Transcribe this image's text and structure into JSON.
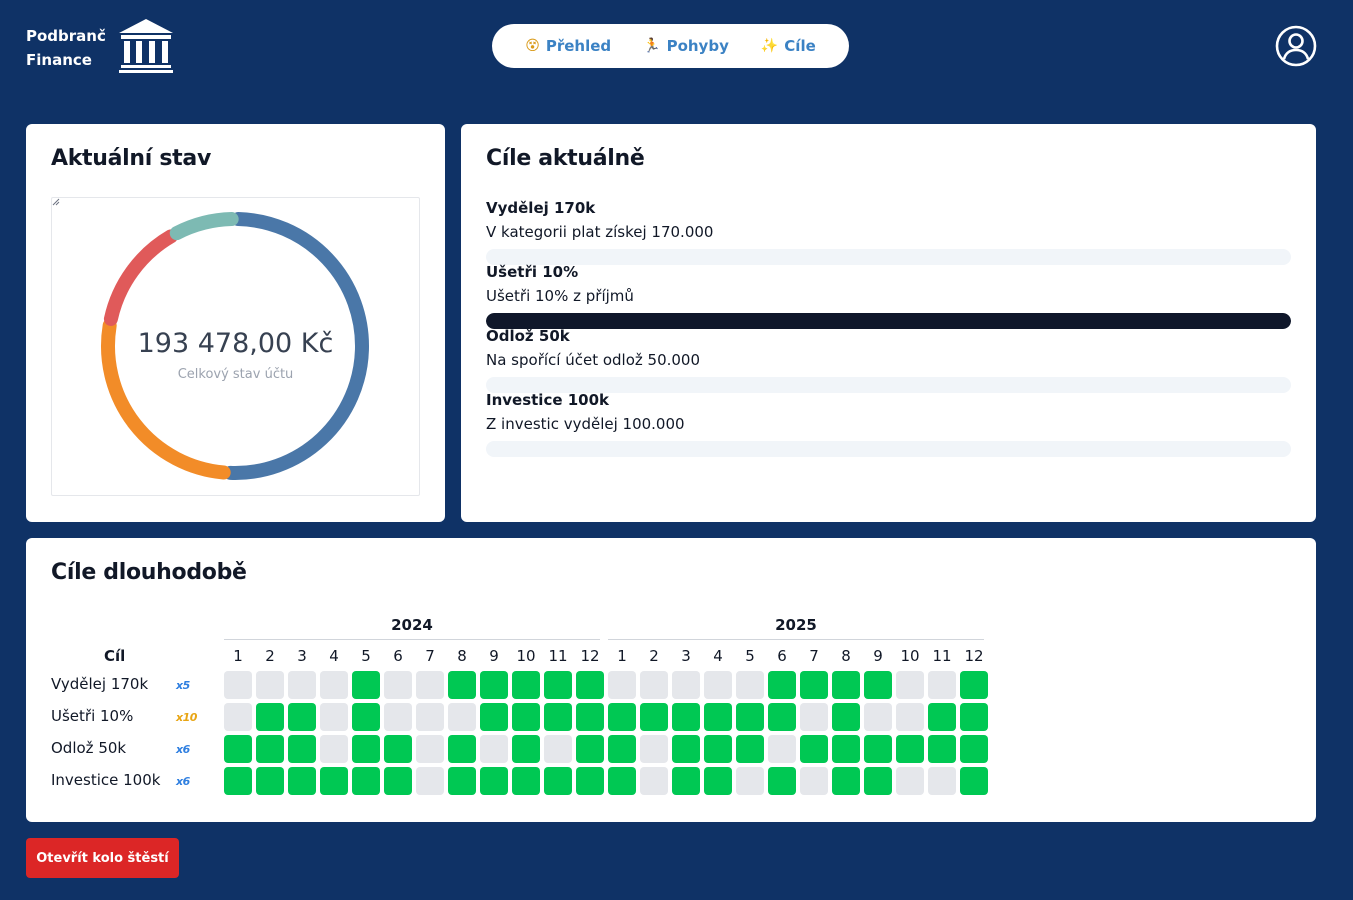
{
  "brand": {
    "name_line1": "Podbranč",
    "name_line2": "Finance",
    "logo_icon": "bank-building-icon"
  },
  "nav": {
    "items": [
      {
        "emoji": "😵",
        "label": "Přehled"
      },
      {
        "emoji": "🏃",
        "label": "Pohyby"
      },
      {
        "emoji": "✨",
        "label": "Cíle"
      }
    ],
    "accent_color": "#3b82c4"
  },
  "user_icon": "user-circle-icon",
  "status": {
    "title": "Aktuální stav",
    "total_value": "193 478,00 Kč",
    "total_label": "Celkový stav účtu",
    "donut": [
      {
        "color": "#4a77a8",
        "percent": 51
      },
      {
        "color": "#f28c28",
        "percent": 27
      },
      {
        "color": "#e05a5a",
        "percent": 14
      },
      {
        "color": "#7dbab3",
        "percent": 8
      }
    ]
  },
  "current_goals": {
    "title": "Cíle aktuálně",
    "items": [
      {
        "title": "Vydělej 170k",
        "desc": "V kategorii plat získej 170.000",
        "progress": 0
      },
      {
        "title": "Ušetři 10%",
        "desc": "Ušetři 10% z příjmů",
        "progress": 100
      },
      {
        "title": "Odlož 50k",
        "desc": "Na spořící účet odlož 50.000",
        "progress": 0
      },
      {
        "title": "Investice 100k",
        "desc": "Z investic vydělej 100.000",
        "progress": 0
      }
    ]
  },
  "long_goals": {
    "title": "Cíle dlouhodobě",
    "goal_header": "Cíl",
    "years": [
      "2024",
      "2025"
    ],
    "months": [
      "1",
      "2",
      "3",
      "4",
      "5",
      "6",
      "7",
      "8",
      "9",
      "10",
      "11",
      "12"
    ],
    "rows": [
      {
        "label": "Vydělej 170k",
        "badge": "x5",
        "badge_color": "#2f7fe0",
        "months_2024": [
          0,
          0,
          0,
          0,
          1,
          0,
          0,
          1,
          1,
          1,
          1,
          1
        ],
        "months_2025": [
          0,
          0,
          0,
          0,
          0,
          1,
          1,
          1,
          1,
          0,
          0,
          1
        ]
      },
      {
        "label": "Ušetři 10%",
        "badge": "x10",
        "badge_color": "#e8a514",
        "months_2024": [
          0,
          1,
          1,
          0,
          1,
          0,
          0,
          0,
          1,
          1,
          1,
          1
        ],
        "months_2025": [
          1,
          1,
          1,
          1,
          1,
          1,
          0,
          1,
          0,
          0,
          1,
          1
        ]
      },
      {
        "label": "Odlož 50k",
        "badge": "x6",
        "badge_color": "#2f7fe0",
        "months_2024": [
          1,
          1,
          1,
          0,
          1,
          1,
          0,
          1,
          0,
          1,
          0,
          1
        ],
        "months_2025": [
          1,
          0,
          1,
          1,
          1,
          0,
          1,
          1,
          1,
          1,
          1,
          1
        ]
      },
      {
        "label": "Investice 100k",
        "badge": "x6",
        "badge_color": "#2f7fe0",
        "months_2024": [
          1,
          1,
          1,
          1,
          1,
          1,
          0,
          1,
          1,
          1,
          1,
          1
        ],
        "months_2025": [
          1,
          0,
          1,
          1,
          0,
          1,
          0,
          1,
          1,
          0,
          0,
          1
        ]
      }
    ],
    "done_color": "#00c853",
    "empty_color": "#e5e7eb"
  },
  "wheel_button": {
    "label": "Otevřít kolo štěstí",
    "color": "#dc2626"
  }
}
